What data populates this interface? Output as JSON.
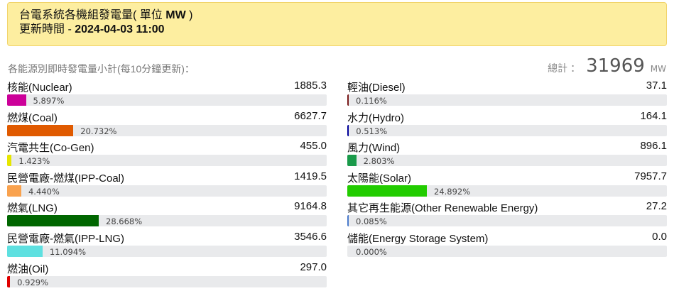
{
  "header": {
    "title_prefix": "台電系統各機組發電量",
    "title_unit": "( 單位 ",
    "title_unit_bold": "MW",
    "title_unit_close": " )",
    "time_label": "更新時間 - ",
    "time_value": "2024-04-03 11:00"
  },
  "summary": {
    "subtitle": "各能源別即時發電量小計(每10分鐘更新)：",
    "total_label": "總計",
    "total_colon": "：",
    "total_value": "31969",
    "total_unit": "MW"
  },
  "left_items": [
    {
      "name": "核能(Nuclear)",
      "value": "1885.3",
      "percent": "5.897%",
      "fraction": 0.05897,
      "color": "#cc0099"
    },
    {
      "name": "燃煤(Coal)",
      "value": "6627.7",
      "percent": "20.732%",
      "fraction": 0.20732,
      "color": "#e05a00"
    },
    {
      "name": "汽電共生(Co-Gen)",
      "value": "455.0",
      "percent": "1.423%",
      "fraction": 0.01423,
      "color": "#e6e600"
    },
    {
      "name": "民營電廠-燃煤(IPP-Coal)",
      "value": "1419.5",
      "percent": "4.440%",
      "fraction": 0.0444,
      "color": "#f9a24e"
    },
    {
      "name": "燃氣(LNG)",
      "value": "9164.8",
      "percent": "28.668%",
      "fraction": 0.28668,
      "color": "#006600"
    },
    {
      "name": "民營電廠-燃氣(IPP-LNG)",
      "value": "3546.6",
      "percent": "11.094%",
      "fraction": 0.11094,
      "color": "#5ee0e0"
    },
    {
      "name": "燃油(Oil)",
      "value": "297.0",
      "percent": "0.929%",
      "fraction": 0.00929,
      "color": "#e00000"
    }
  ],
  "right_items": [
    {
      "name": "輕油(Diesel)",
      "value": "37.1",
      "percent": "0.116%",
      "fraction": 0.00116,
      "color": "#7a1a1a"
    },
    {
      "name": "水力(Hydro)",
      "value": "164.1",
      "percent": "0.513%",
      "fraction": 0.00513,
      "color": "#000099"
    },
    {
      "name": "風力(Wind)",
      "value": "896.1",
      "percent": "2.803%",
      "fraction": 0.02803,
      "color": "#1a9a4a"
    },
    {
      "name": "太陽能(Solar)",
      "value": "7957.7",
      "percent": "24.892%",
      "fraction": 0.24892,
      "color": "#22cc00"
    },
    {
      "name": "其它再生能源(Other Renewable Energy)",
      "value": "27.2",
      "percent": "0.085%",
      "fraction": 0.00085,
      "color": "#4a7acc"
    },
    {
      "name": "儲能(Energy Storage System)",
      "value": "0.0",
      "percent": "0.000%",
      "fraction": 0.0,
      "color": "#888888"
    }
  ]
}
